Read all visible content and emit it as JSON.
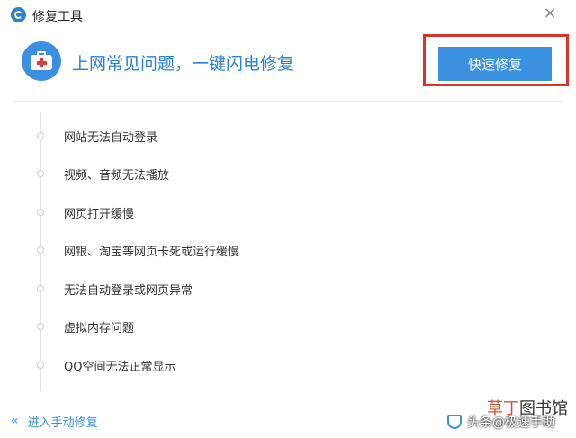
{
  "window": {
    "title": "修复工具",
    "close_glyph": "×"
  },
  "hero": {
    "icon": "first-aid-kit-icon",
    "headline": "上网常见问题，一键闪电修复",
    "quick_fix_label": "快速修复"
  },
  "issues": [
    {
      "label": "网站无法自动登录"
    },
    {
      "label": "视频、音频无法播放"
    },
    {
      "label": "网页打开缓慢"
    },
    {
      "label": "网银、淘宝等网页卡死或运行缓慢"
    },
    {
      "label": "无法自动登录或网页异常"
    },
    {
      "label": "虚拟内存问题"
    },
    {
      "label": "QQ空间无法正常显示"
    }
  ],
  "footer": {
    "arrow_glyph": "«",
    "manual_fix_label": "进入手动修复"
  },
  "watermark": {
    "site_char1": "草",
    "site_char2": "丁",
    "site_char3": "图书馆",
    "toutiao_text": "头条@极速手助"
  },
  "colors": {
    "accent": "#3c92e0",
    "headline": "#2a80d8",
    "highlight_border": "#d9342b",
    "kit_cross": "#e0383b"
  }
}
